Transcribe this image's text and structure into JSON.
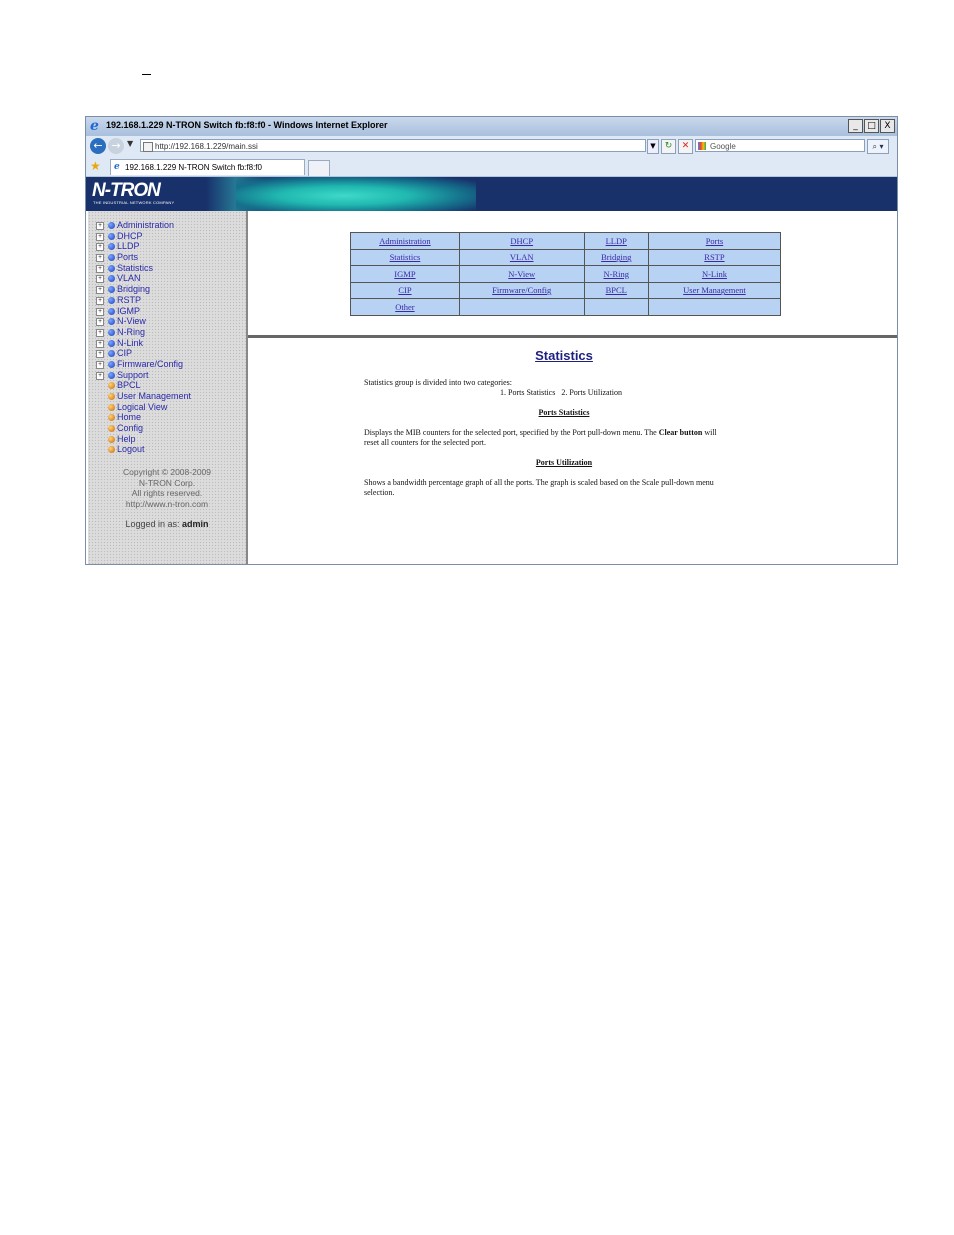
{
  "browser": {
    "title": "192.168.1.229 N-TRON Switch fb:f8:f0 - Windows Internet Explorer",
    "controls": {
      "minimize": "_",
      "maximize": "□",
      "close": "X"
    },
    "url": "http://192.168.1.229/main.ssi",
    "search_placeholder": "Google",
    "tab_title": "192.168.1.229 N-TRON Switch fb:f8:f0"
  },
  "banner": {
    "logo": "N-TRON",
    "tagline": "THE INDUSTRIAL NETWORK COMPANY"
  },
  "sidebar": {
    "items": [
      {
        "label": "Administration",
        "expandable": true,
        "dot": "blue"
      },
      {
        "label": "DHCP",
        "expandable": true,
        "dot": "blue"
      },
      {
        "label": "LLDP",
        "expandable": true,
        "dot": "blue"
      },
      {
        "label": "Ports",
        "expandable": true,
        "dot": "blue"
      },
      {
        "label": "Statistics",
        "expandable": true,
        "dot": "blue"
      },
      {
        "label": "VLAN",
        "expandable": true,
        "dot": "blue"
      },
      {
        "label": "Bridging",
        "expandable": true,
        "dot": "blue"
      },
      {
        "label": "RSTP",
        "expandable": true,
        "dot": "blue"
      },
      {
        "label": "IGMP",
        "expandable": true,
        "dot": "blue"
      },
      {
        "label": "N-View",
        "expandable": true,
        "dot": "blue"
      },
      {
        "label": "N-Ring",
        "expandable": true,
        "dot": "blue"
      },
      {
        "label": "N-Link",
        "expandable": true,
        "dot": "blue"
      },
      {
        "label": "CIP",
        "expandable": true,
        "dot": "blue"
      },
      {
        "label": "Firmware/Config",
        "expandable": true,
        "dot": "blue"
      },
      {
        "label": "Support",
        "expandable": true,
        "dot": "blue"
      },
      {
        "label": "BPCL",
        "expandable": false,
        "dot": "orange"
      },
      {
        "label": "User Management",
        "expandable": false,
        "dot": "orange"
      },
      {
        "label": "Logical View",
        "expandable": false,
        "dot": "orange"
      },
      {
        "label": "Home",
        "expandable": false,
        "dot": "orange"
      },
      {
        "label": "Config",
        "expandable": false,
        "dot": "orange"
      },
      {
        "label": "Help",
        "expandable": false,
        "dot": "orange"
      },
      {
        "label": "Logout",
        "expandable": false,
        "dot": "orange"
      }
    ],
    "copyright": [
      "Copyright © 2008-2009",
      "N-TRON Corp.",
      "All rights reserved.",
      "http://www.n-tron.com"
    ],
    "logged_in_label": "Logged in as:",
    "logged_in_user": "admin"
  },
  "nav_table": [
    [
      "Administration",
      "DHCP",
      "LLDP",
      "Ports"
    ],
    [
      "Statistics",
      "VLAN",
      "Bridging",
      "RSTP"
    ],
    [
      "IGMP",
      "N-View",
      "N-Ring",
      "N-Link"
    ],
    [
      "CIP",
      "Firmware/Config",
      "BPCL",
      "User Management"
    ],
    [
      "Other",
      "",
      "",
      ""
    ]
  ],
  "main": {
    "title": "Statistics",
    "intro": "Statistics group is divided into two categories:",
    "categories": "1. Ports Statistics   2. Ports Utilization",
    "section1_title": "Ports Statistics",
    "section1_line1_a": "Displays the MIB counters for the selected port, specified by the Port pull-down menu. The ",
    "section1_line1_b": "Clear button",
    "section1_line1_c": " will",
    "section1_line2": "reset all counters for the selected port.",
    "section2_title": "Ports Utilization",
    "section2_line1": "Shows a bandwidth percentage graph of all the ports. The graph is scaled based on the Scale pull-down menu",
    "section2_line2": "selection."
  }
}
